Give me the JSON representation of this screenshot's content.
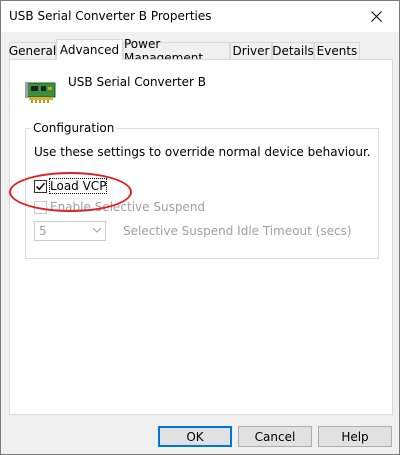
{
  "window": {
    "title": "USB Serial Converter B Properties",
    "close_glyph": "✕",
    "accent_color": "#0078d7"
  },
  "tabs": [
    {
      "label": "General",
      "active": false
    },
    {
      "label": "Advanced",
      "active": true
    },
    {
      "label": "Power Management",
      "active": false
    },
    {
      "label": "Driver",
      "active": false
    },
    {
      "label": "Details",
      "active": false
    },
    {
      "label": "Events",
      "active": false
    }
  ],
  "device": {
    "icon": "usb-device-board-icon",
    "name": "USB Serial Converter B"
  },
  "configuration": {
    "title": "Configuration",
    "description": "Use these settings to override normal device behaviour.",
    "load_vcp": {
      "label": "Load VCP",
      "checked": true
    },
    "selective_suspend": {
      "label": "Enable Selective Suspend",
      "checked": false,
      "enabled": false
    },
    "idle_timeout": {
      "value": "5",
      "label": "Selective Suspend Idle Timeout (secs)",
      "enabled": false
    }
  },
  "annotation": {
    "color": "#e21f1f"
  },
  "buttons": {
    "ok": "OK",
    "cancel": "Cancel",
    "help": "Help"
  }
}
